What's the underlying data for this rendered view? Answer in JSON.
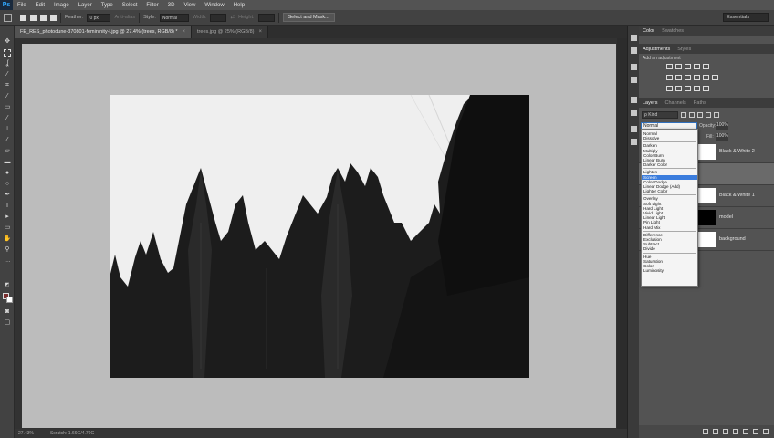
{
  "menubar": {
    "logo": "Ps",
    "items": [
      "File",
      "Edit",
      "Image",
      "Layer",
      "Type",
      "Select",
      "Filter",
      "3D",
      "View",
      "Window",
      "Help"
    ]
  },
  "options": {
    "feather_label": "Feather:",
    "feather_value": "0 px",
    "antialias_label": "Anti-alias",
    "style_label": "Style:",
    "style_value": "Normal",
    "width_label": "Width:",
    "height_label": "Height:",
    "select_mask_label": "Select and Mask...",
    "workspace": "Essentials"
  },
  "tabs": [
    {
      "label": "FE_RES_photodune-370801-femininity-l.jpg @ 27.4% (trees, RGB/8) *",
      "close": "×"
    },
    {
      "label": "trees.jpg @ 25% (RGB/8)",
      "close": "×"
    }
  ],
  "status": {
    "zoom": "27.43%",
    "scratch": "Scratch: 1.66G/4.70G"
  },
  "panels": {
    "top_tabs": [
      "Color",
      "Swatches"
    ],
    "adj_tabs": [
      "Adjustments",
      "Styles"
    ],
    "add_adjustment": "Add an adjustment",
    "layer_tabs": [
      "Layers",
      "Channels",
      "Paths"
    ],
    "kind": "ρ Kind",
    "blend_mode": "Normal",
    "opacity_label": "Opacity:",
    "opacity_value": "100%",
    "fill_label": "Fill:",
    "fill_value": "100%"
  },
  "layers": [
    {
      "name": "Black & White 2",
      "thumb": "#ffffff",
      "selected": false
    },
    {
      "name": "",
      "thumb": "#6a6a6a",
      "selected": true
    },
    {
      "name": "Black & White 1",
      "thumb": "#ffffff",
      "selected": false
    },
    {
      "name": "model",
      "thumb": "#000000",
      "selected": false
    },
    {
      "name": "background",
      "thumb": "#ffffff",
      "selected": false
    }
  ],
  "blend_menu": [
    [
      "Normal",
      "Dissolve"
    ],
    [
      "Darken",
      "Multiply",
      "Color Burn",
      "Linear Burn",
      "Darker Color"
    ],
    [
      "Lighten",
      "Screen",
      "Color Dodge",
      "Linear Dodge (Add)",
      "Lighter Color"
    ],
    [
      "Overlay",
      "Soft Light",
      "Hard Light",
      "Vivid Light",
      "Linear Light",
      "Pin Light",
      "Hard Mix"
    ],
    [
      "Difference",
      "Exclusion",
      "Subtract",
      "Divide"
    ],
    [
      "Hue",
      "Saturation",
      "Color",
      "Luminosity"
    ]
  ],
  "blend_menu_highlight": "Screen",
  "colors": {
    "accent": "#3b7ddd",
    "foreground_swatch": "#7a2e2e",
    "background_swatch": "#ffffff"
  }
}
